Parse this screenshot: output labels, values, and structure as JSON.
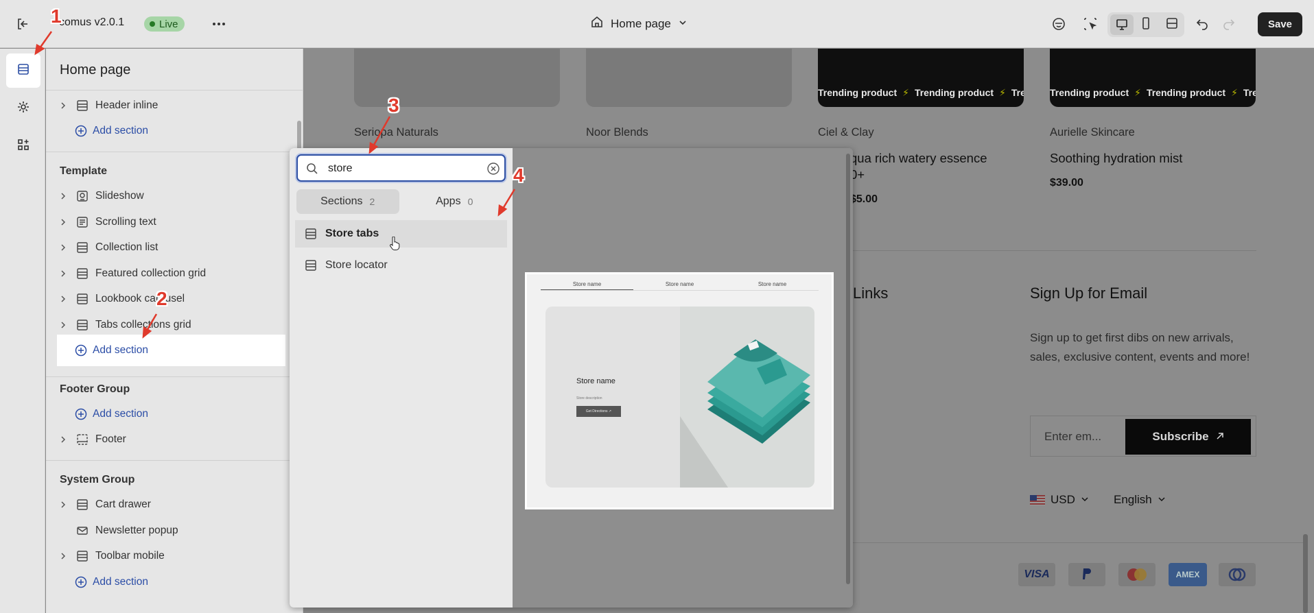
{
  "topbar": {
    "app_title": "comus v2.0.1",
    "live_label": "Live",
    "page_name": "Home page",
    "save_label": "Save"
  },
  "sidebar": {
    "title": "Home page",
    "header_item": "Header inline",
    "add_section_label": "Add section",
    "template_label": "Template",
    "template_items": [
      "Slideshow",
      "Scrolling text",
      "Collection list",
      "Featured collection grid",
      "Lookbook carousel",
      "Tabs collections grid"
    ],
    "footer_group_label": "Footer Group",
    "footer_item": "Footer",
    "system_group_label": "System Group",
    "system_items": [
      "Cart drawer",
      "Newsletter popup",
      "Toolbar mobile"
    ]
  },
  "popup": {
    "search_value": "store",
    "tabs": [
      {
        "label": "Sections",
        "count": "2"
      },
      {
        "label": "Apps",
        "count": "0"
      }
    ],
    "results": [
      "Store tabs",
      "Store locator"
    ],
    "preview": {
      "tabs": [
        "Store name",
        "Store name",
        "Store name"
      ],
      "store_name": "Store name",
      "store_description": "Store description",
      "button_label": "Get Directions ↗"
    }
  },
  "preview": {
    "trending_text": "Trending product",
    "products": [
      {
        "vendor": "Seriopa Naturals"
      },
      {
        "vendor": "Noor Blends"
      },
      {
        "vendor": "Ciel & Clay",
        "title_line1": "qua rich watery essence",
        "title_line2": "0+",
        "price": "$5.00"
      },
      {
        "vendor": "Aurielle Skincare",
        "title_line1": "Soothing hydration mist",
        "price": "$39.00"
      }
    ],
    "links_heading": "Links",
    "signup_heading": "Sign Up for Email",
    "signup_text": "Sign up to get first dibs on new arrivals, sales, exclusive content, events and more!",
    "email_placeholder": "Enter em...",
    "subscribe_label": "Subscribe",
    "currency": "USD",
    "language": "English",
    "payments": [
      "VISA",
      "PayPal",
      "",
      "AMEX",
      ""
    ]
  },
  "annotations": [
    "1",
    "2",
    "3",
    "4"
  ],
  "colors": {
    "accent": "#2c4ea3",
    "marker": "#e03a2c",
    "live": "#267a26"
  }
}
